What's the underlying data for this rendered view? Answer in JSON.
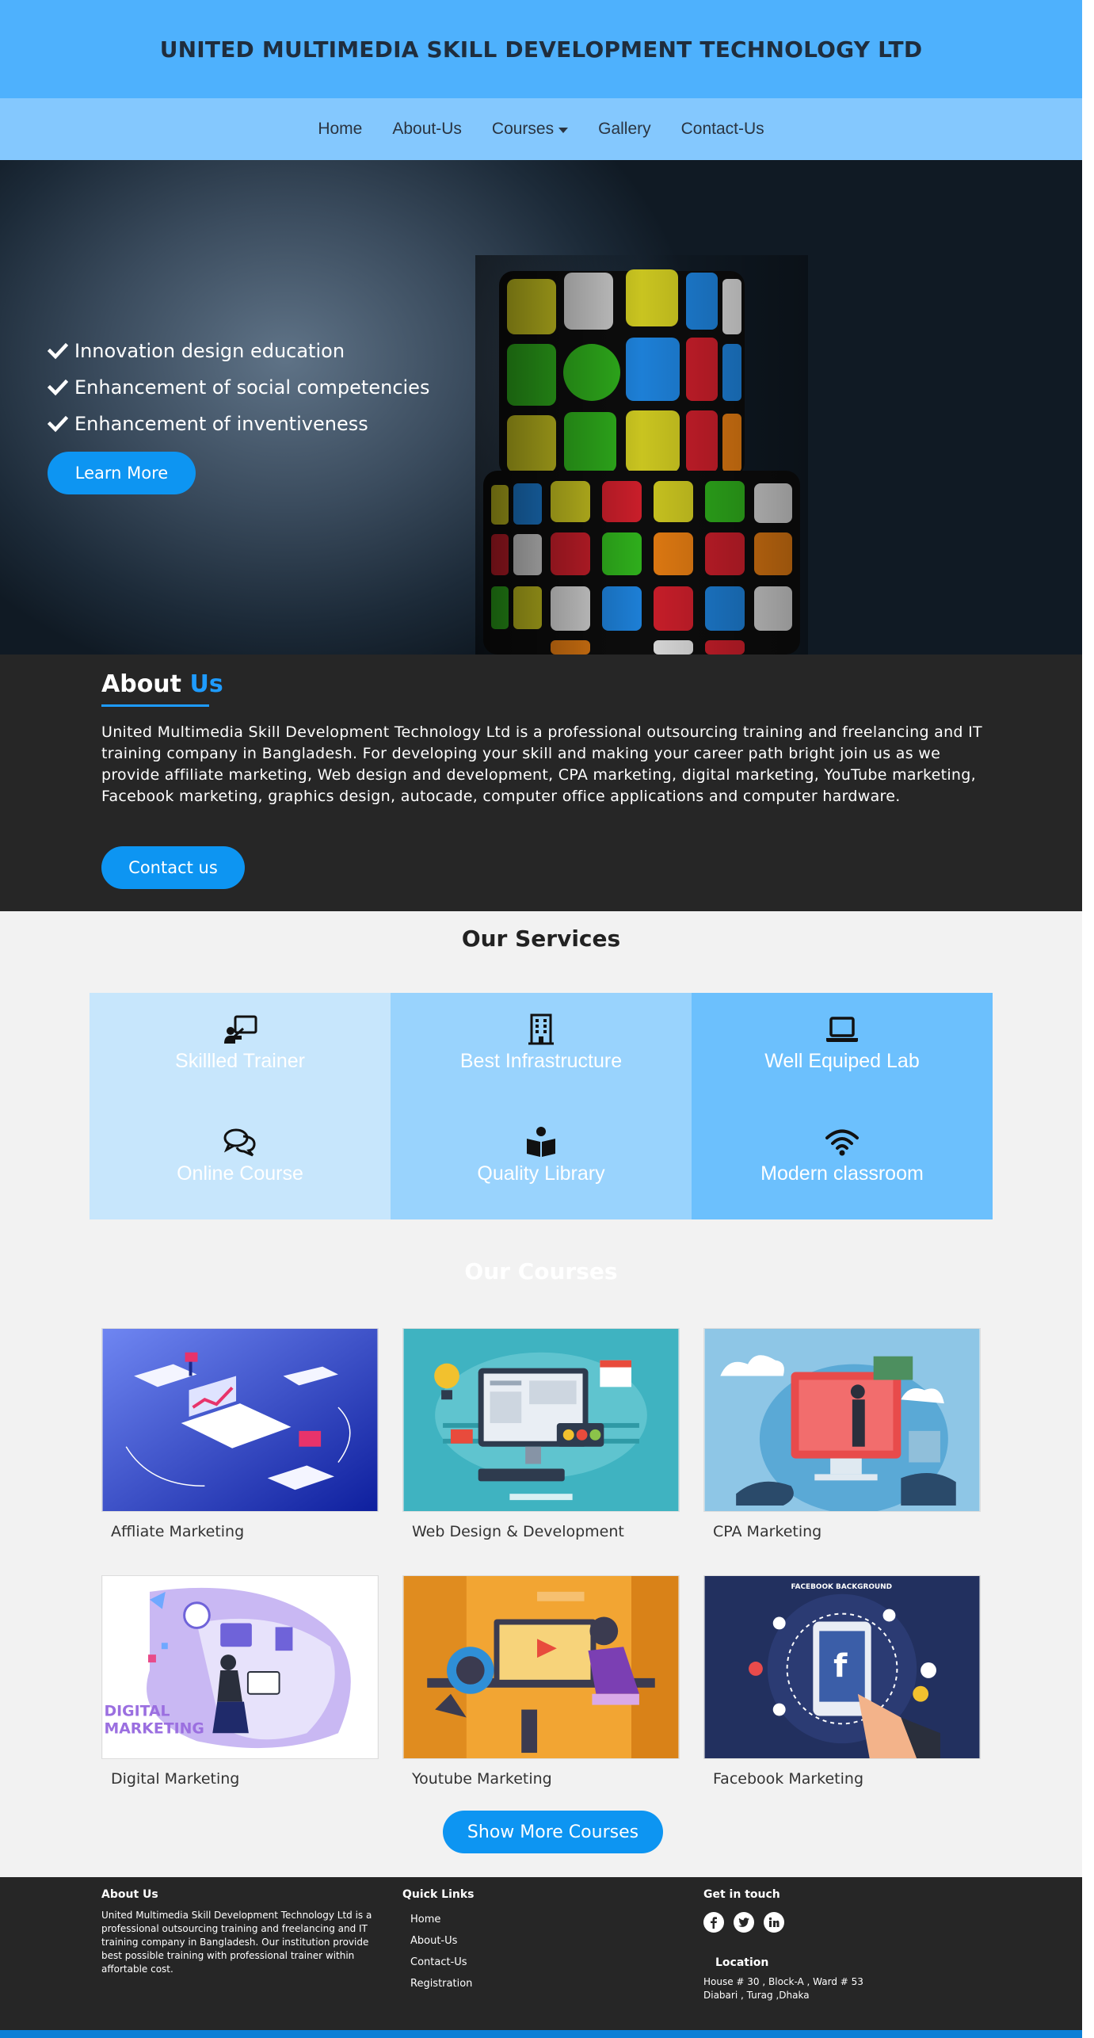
{
  "header": {
    "title": "UNITED MULTIMEDIA SKILL DEVELOPMENT TECHNOLOGY LTD"
  },
  "nav": {
    "items": [
      {
        "label": "Home"
      },
      {
        "label": "About-Us"
      },
      {
        "label": "Courses",
        "dropdown": true
      },
      {
        "label": "Gallery"
      },
      {
        "label": "Contact-Us"
      }
    ]
  },
  "hero": {
    "points": [
      "Innovation design education",
      "Enhancement of social competencies",
      "Enhancement of inventiveness"
    ],
    "button_label": "Learn More",
    "icon": "check-icon"
  },
  "about": {
    "title_plain": "About",
    "title_accent": "Us",
    "text": "United Multimedia Skill Development Technology Ltd is a professional outsourcing training and freelancing and IT training company in Bangladesh. For developing your skill and making your career path bright join us as we provide affiliate marketing, Web design and development, CPA marketing, digital marketing, YouTube marketing, Facebook marketing, graphics design, autocade, computer office applications and computer hardware.",
    "button_label": "Contact us"
  },
  "services": {
    "title": "Our Services",
    "items": [
      {
        "label": "Skillled Trainer",
        "icon": "trainer-icon"
      },
      {
        "label": "Best Infrastructure",
        "icon": "building-icon"
      },
      {
        "label": "Well Equiped Lab",
        "icon": "laptop-icon"
      },
      {
        "label": "Online Course",
        "icon": "chat-icon"
      },
      {
        "label": "Quality Library",
        "icon": "book-reader-icon"
      },
      {
        "label": "Modern classroom",
        "icon": "wifi-icon"
      }
    ],
    "colors": [
      "#c7e6fc",
      "#99d3fd",
      "#6cc0fd"
    ]
  },
  "courses": {
    "title": "Our Courses",
    "items": [
      {
        "name": "Affliate Marketing"
      },
      {
        "name": "Web Design & Development"
      },
      {
        "name": "CPA Marketing"
      },
      {
        "name": "Digital Marketing"
      },
      {
        "name": "Youtube Marketing"
      },
      {
        "name": "Facebook Marketing"
      }
    ],
    "more_label": "Show More Courses"
  },
  "footer": {
    "about_head": "About Us",
    "about_text": "United Multimedia Skill Development Technology Ltd is a professional outsourcing training and freelancing and IT training company in Bangladesh. Our institution provide best possible training with professional trainer within affortable cost.",
    "links_head": "Quick Links",
    "links": [
      "Home",
      "About-Us",
      "Contact-Us",
      "Registration"
    ],
    "contact_head": "Get in touch",
    "social": [
      "facebook-icon",
      "twitter-icon",
      "linkedin-icon"
    ],
    "location_head": "Location",
    "address_line1": "House # 30 , Block-A , Ward # 53",
    "address_line2": "Diabari , Turag ,Dhaka"
  },
  "colors": {
    "header_bg": "#4eb1fd",
    "nav_bg": "#84c8fe",
    "accent": "#0d95f2",
    "dark": "#262626"
  }
}
